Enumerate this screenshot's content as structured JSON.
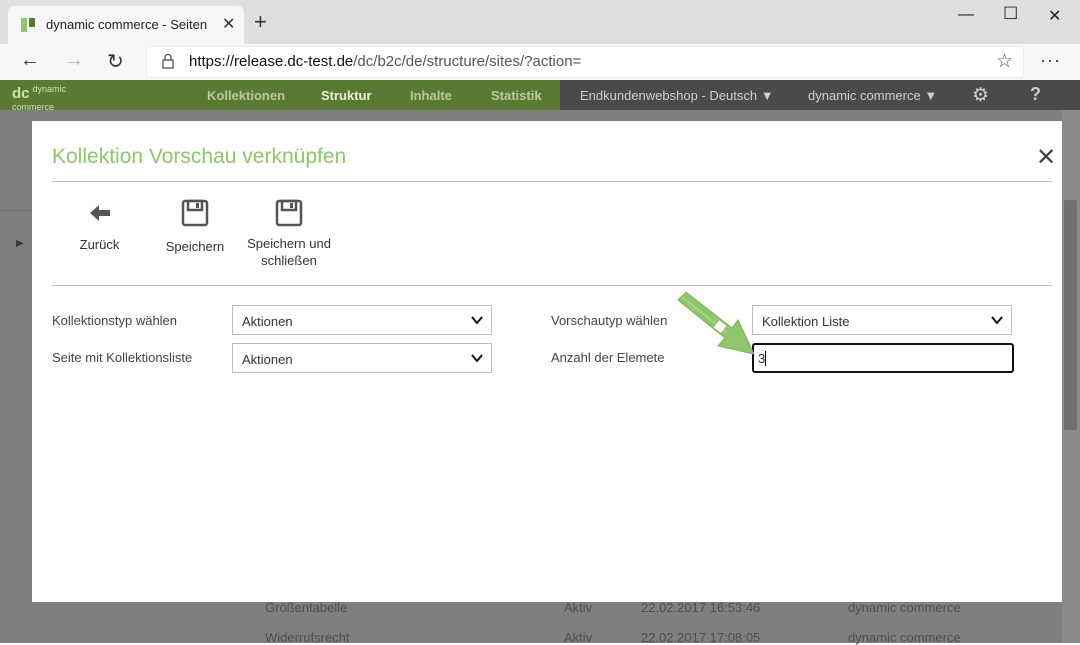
{
  "browser": {
    "tab_title": "dynamic commerce - Seiten",
    "url_host": "https://release.dc-test.de",
    "url_path": "/dc/b2c/de/structure/sites/?action=",
    "window_controls": [
      "minimize-icon",
      "maximize-icon",
      "close-icon"
    ]
  },
  "app": {
    "logo_line1": "dynamic",
    "logo_line2": "commerce",
    "nav": [
      "Kollektionen",
      "Struktur",
      "Inhalte",
      "Statistik"
    ],
    "active_nav": "Struktur",
    "shop_select": "Endkundenwebshop - Deutsch",
    "account_select": "dynamic commerce",
    "colors": {
      "green": "#5a7a33",
      "accent": "#8fc56c"
    }
  },
  "background_rows": [
    {
      "name": "Größentabelle",
      "status": "Aktiv",
      "date": "22.02.2017 16:53:46",
      "user": "dynamic commerce"
    },
    {
      "name": "Widerrufsrecht",
      "status": "Aktiv",
      "date": "22.02.2017 17:08:05",
      "user": "dynamic commerce"
    }
  ],
  "modal": {
    "title": "Kollektion Vorschau verknüpfen",
    "toolbar": {
      "back_label": "Zurück",
      "save_label": "Speichern",
      "save_close_line1": "Speichern und",
      "save_close_line2": "schließen"
    },
    "form": {
      "collection_type_label": "Kollektionstyp wählen",
      "collection_type_value": "Aktionen",
      "collection_page_label": "Seite mit Kollektionsliste",
      "collection_page_value": "Aktionen",
      "preview_type_label": "Vorschautyp wählen",
      "preview_type_value": "Kollektion Liste",
      "element_count_label": "Anzahl der Elemete",
      "element_count_value": "3"
    }
  }
}
